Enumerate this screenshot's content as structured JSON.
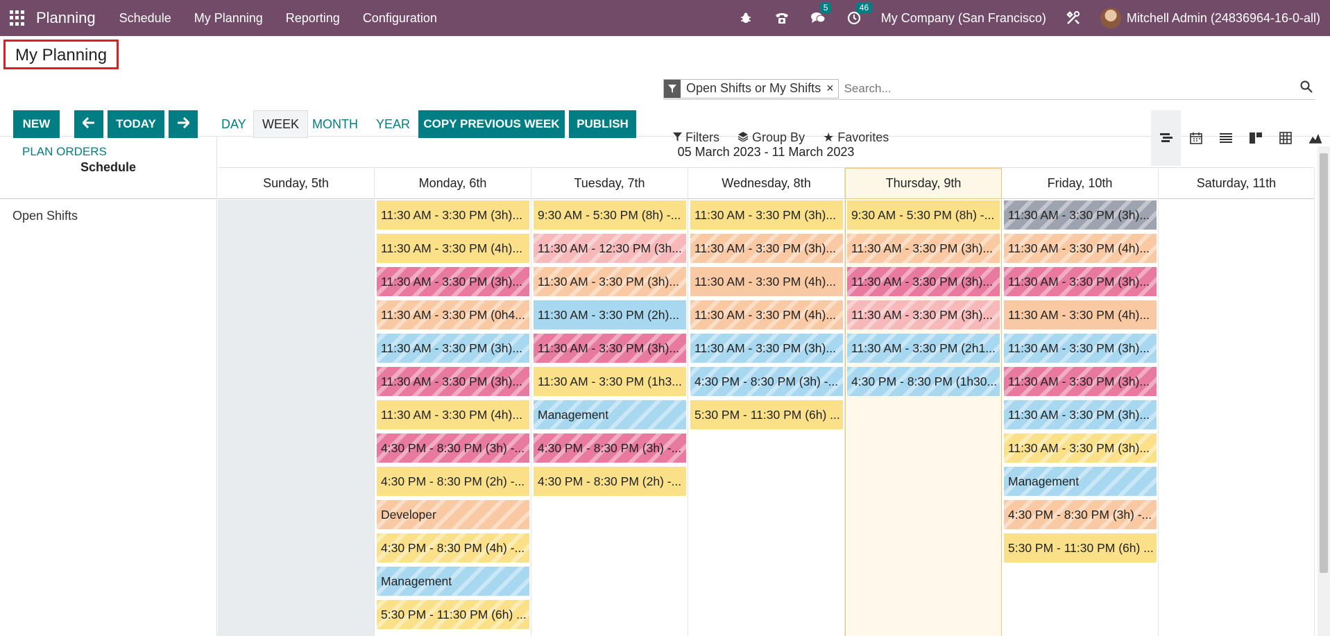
{
  "navbar": {
    "brand": "Planning",
    "menu": [
      "Schedule",
      "My Planning",
      "Reporting",
      "Configuration"
    ],
    "messages_count": "5",
    "activities_count": "46",
    "company": "My Company (San Francisco)",
    "user": "Mitchell Admin (24836964-16-0-all)"
  },
  "page": {
    "title": "My Planning"
  },
  "buttons": {
    "new": "NEW",
    "today": "TODAY",
    "copy_previous_week": "COPY PREVIOUS WEEK",
    "publish": "PUBLISH",
    "plan_orders": "PLAN ORDERS"
  },
  "scales": [
    "DAY",
    "WEEK",
    "MONTH",
    "YEAR"
  ],
  "search": {
    "facet": "Open Shifts or My Shifts",
    "placeholder": "Search..."
  },
  "search_options": [
    "Filters",
    "Group By",
    "Favorites"
  ],
  "gantt": {
    "row_header": "Schedule",
    "range": "05 March 2023 - 11 March 2023",
    "days": [
      "Sunday, 5th",
      "Monday, 6th",
      "Tuesday, 7th",
      "Wednesday, 8th",
      "Thursday, 9th",
      "Friday, 10th",
      "Saturday, 11th"
    ],
    "row_label": "Open Shifts",
    "columns": [
      [],
      [
        {
          "text": "11:30 AM - 3:30 PM (3h)...",
          "color": "#fbe08a",
          "stripe": false
        },
        {
          "text": "11:30 AM - 3:30 PM (4h)...",
          "color": "#fbe08a",
          "stripe": false
        },
        {
          "text": "11:30 AM - 3:30 PM (3h)...",
          "color": "#e87aa0",
          "stripe": true
        },
        {
          "text": "11:30 AM - 3:30 PM (0h4...",
          "color": "#f8c9a2",
          "stripe": true
        },
        {
          "text": "11:30 AM - 3:30 PM (3h)...",
          "color": "#a8d8f0",
          "stripe": true
        },
        {
          "text": "11:30 AM - 3:30 PM (3h)...",
          "color": "#e87aa0",
          "stripe": true
        },
        {
          "text": "11:30 AM - 3:30 PM (4h)...",
          "color": "#fbe08a",
          "stripe": false
        },
        {
          "text": "4:30 PM - 8:30 PM (3h) -...",
          "color": "#e87aa0",
          "stripe": true
        },
        {
          "text": "4:30 PM - 8:30 PM (2h) -...",
          "color": "#fbe08a",
          "stripe": false
        },
        {
          "text": "Developer",
          "color": "#f8c9a2",
          "stripe": true
        },
        {
          "text": "4:30 PM - 8:30 PM (4h) -...",
          "color": "#fbe08a",
          "stripe": true
        },
        {
          "text": "Management",
          "color": "#a8d8f0",
          "stripe": true
        },
        {
          "text": "5:30 PM - 11:30 PM (6h) ...",
          "color": "#fbe08a",
          "stripe": true
        }
      ],
      [
        {
          "text": "9:30 AM - 5:30 PM (8h) -...",
          "color": "#fbe08a",
          "stripe": false
        },
        {
          "text": "11:30 AM - 12:30 PM (3h...",
          "color": "#f6b8b8",
          "stripe": true
        },
        {
          "text": "11:30 AM - 3:30 PM (3h)...",
          "color": "#f8c9a2",
          "stripe": true
        },
        {
          "text": "11:30 AM - 3:30 PM (2h)...",
          "color": "#a8d8f0",
          "stripe": false
        },
        {
          "text": "11:30 AM - 3:30 PM (3h)...",
          "color": "#e87aa0",
          "stripe": true
        },
        {
          "text": "11:30 AM - 3:30 PM (1h3...",
          "color": "#fbe08a",
          "stripe": false
        },
        {
          "text": "Management",
          "color": "#a8d8f0",
          "stripe": true
        },
        {
          "text": "4:30 PM - 8:30 PM (3h) -...",
          "color": "#e87aa0",
          "stripe": true
        },
        {
          "text": "4:30 PM - 8:30 PM (2h) -...",
          "color": "#fbe08a",
          "stripe": false
        }
      ],
      [
        {
          "text": "11:30 AM - 3:30 PM (3h)...",
          "color": "#fbe08a",
          "stripe": false
        },
        {
          "text": "11:30 AM - 3:30 PM (3h)...",
          "color": "#f8c9a2",
          "stripe": true
        },
        {
          "text": "11:30 AM - 3:30 PM (4h)...",
          "color": "#f8c9a2",
          "stripe": false
        },
        {
          "text": "11:30 AM - 3:30 PM (4h)...",
          "color": "#f8c9a2",
          "stripe": true
        },
        {
          "text": "11:30 AM - 3:30 PM (3h)...",
          "color": "#a8d8f0",
          "stripe": true
        },
        {
          "text": "4:30 PM - 8:30 PM (3h) -...",
          "color": "#a8d8f0",
          "stripe": true
        },
        {
          "text": "5:30 PM - 11:30 PM (6h) ...",
          "color": "#fbe08a",
          "stripe": false
        }
      ],
      [
        {
          "text": "9:30 AM - 5:30 PM (8h) -...",
          "color": "#fbe08a",
          "stripe": false
        },
        {
          "text": "11:30 AM - 3:30 PM (3h)...",
          "color": "#f8c9a2",
          "stripe": true
        },
        {
          "text": "11:30 AM - 3:30 PM (3h)...",
          "color": "#e87aa0",
          "stripe": true
        },
        {
          "text": "11:30 AM - 3:30 PM (3h)...",
          "color": "#f6b8b8",
          "stripe": true
        },
        {
          "text": "11:30 AM - 3:30 PM (2h1...",
          "color": "#a8d8f0",
          "stripe": true
        },
        {
          "text": "4:30 PM - 8:30 PM (1h30...",
          "color": "#a8d8f0",
          "stripe": true
        }
      ],
      [
        {
          "text": "11:30 AM - 3:30 PM (3h)...",
          "color": "#9ea3b0",
          "stripe": true
        },
        {
          "text": "11:30 AM - 3:30 PM (4h)...",
          "color": "#f8c9a2",
          "stripe": true
        },
        {
          "text": "11:30 AM - 3:30 PM (3h)...",
          "color": "#e87aa0",
          "stripe": true
        },
        {
          "text": "11:30 AM - 3:30 PM (4h)...",
          "color": "#f8c9a2",
          "stripe": false
        },
        {
          "text": "11:30 AM - 3:30 PM (3h)...",
          "color": "#a8d8f0",
          "stripe": true
        },
        {
          "text": "11:30 AM - 3:30 PM (3h)...",
          "color": "#e87aa0",
          "stripe": true
        },
        {
          "text": "11:30 AM - 3:30 PM (3h)...",
          "color": "#a8d8f0",
          "stripe": true
        },
        {
          "text": "11:30 AM - 3:30 PM (3h)...",
          "color": "#fbe08a",
          "stripe": true
        },
        {
          "text": "Management",
          "color": "#a8d8f0",
          "stripe": true
        },
        {
          "text": "4:30 PM - 8:30 PM (3h) -...",
          "color": "#f8c9a2",
          "stripe": true
        },
        {
          "text": "5:30 PM - 11:30 PM (6h) ...",
          "color": "#fbe08a",
          "stripe": false
        }
      ],
      []
    ]
  }
}
